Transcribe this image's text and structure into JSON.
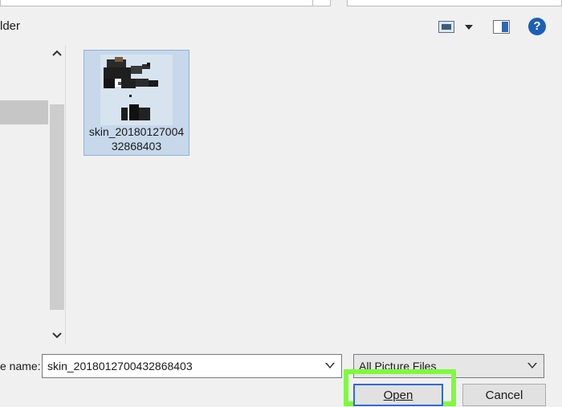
{
  "window": {
    "breadcrumb_partial": "lder",
    "scroll_up_glyph": "^",
    "scroll_down_glyph": "v"
  },
  "toolbar": {
    "icons": [
      "view-options-icon",
      "preview-pane-icon",
      "help-icon"
    ],
    "help_label": "?"
  },
  "files": [
    {
      "name": "skin_20180127004\n32868403",
      "selected": true,
      "icon": "image-thumbnail-icon"
    }
  ],
  "filename": {
    "label": "e name:",
    "value": "skin_2018012700432868403"
  },
  "filetype": {
    "selected": "All Picture Files"
  },
  "buttons": {
    "open_label": "Open",
    "cancel_label": "Cancel"
  },
  "colors": {
    "accent_blue": "#2f6bd1",
    "selection_fill": "#c6d8ea",
    "highlight_green": "#7cfc3c",
    "help_blue": "#1d5fb7"
  }
}
